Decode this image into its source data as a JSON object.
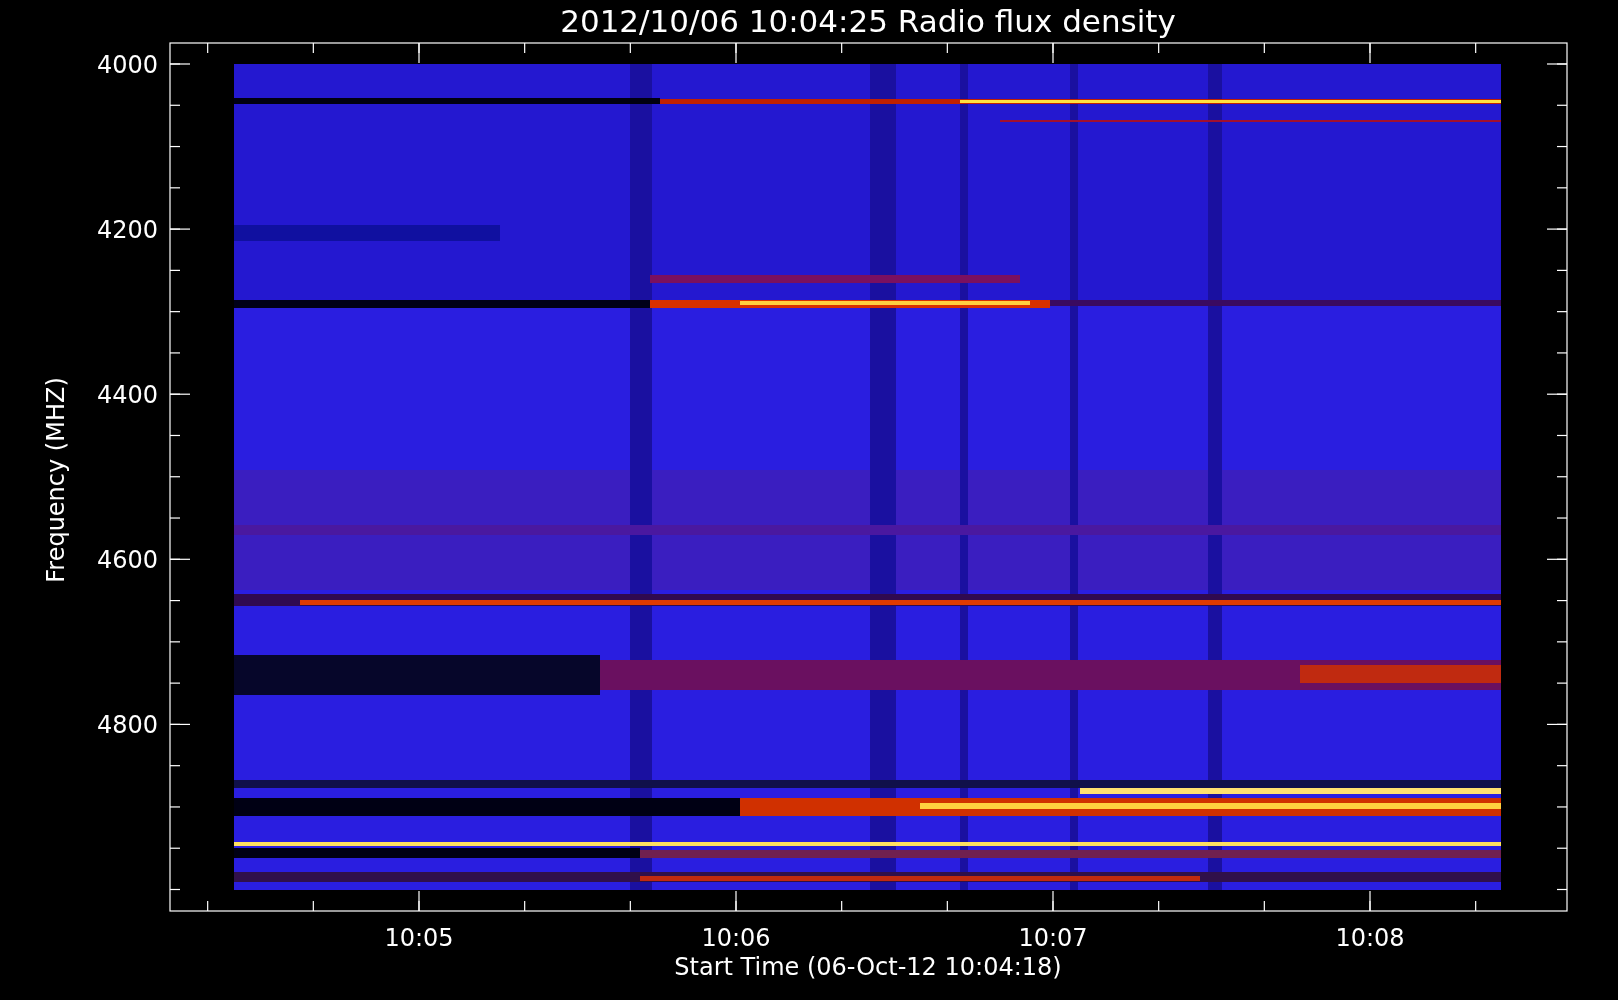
{
  "title": "2012/10/06 10:04:25 Radio flux density",
  "ylabel": "Frequency (MHZ)",
  "xlabel": "Start Time (06-Oct-12 10:04:18)",
  "yticks": [
    "4000",
    "4200",
    "4400",
    "4600",
    "4800"
  ],
  "xticks": [
    "10:05",
    "10:06",
    "10:07",
    "10:08"
  ]
}
